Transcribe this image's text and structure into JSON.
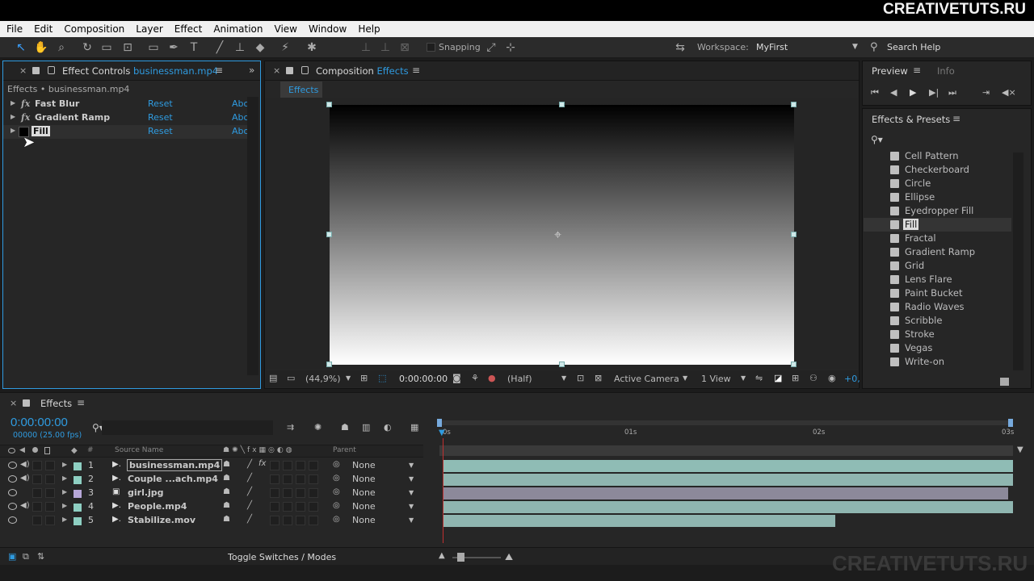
{
  "brand": "CREATIVETUTS.RU",
  "watermark": "CREATIVETUTS.RU",
  "menu": [
    "File",
    "Edit",
    "Composition",
    "Layer",
    "Effect",
    "Animation",
    "View",
    "Window",
    "Help"
  ],
  "toolbar": {
    "snapping_label": "Snapping",
    "workspace_label": "Workspace:",
    "workspace_value": "MyFirst",
    "search_help": "Search Help"
  },
  "effect_controls": {
    "tab_title": "Effect Controls",
    "tab_layer": "businessman.mp4",
    "breadcrumb": "Effects • businessman.mp4",
    "effects": [
      {
        "name": "Fast Blur",
        "reset": "Reset",
        "about": "Abo"
      },
      {
        "name": "Gradient Ramp",
        "reset": "Reset",
        "about": "Abo"
      },
      {
        "name": "Fill",
        "reset": "Reset",
        "about": "Abo"
      }
    ]
  },
  "composition": {
    "tab_title": "Composition",
    "tab_name": "Effects",
    "sub_tab": "Effects",
    "zoom": "(44,9%)",
    "timecode": "0:00:00:00",
    "resolution": "(Half)",
    "camera": "Active Camera",
    "views": "1 View",
    "offset": "+0,"
  },
  "preview": {
    "tab_preview": "Preview",
    "tab_info": "Info"
  },
  "effects_presets": {
    "title": "Effects & Presets",
    "items": [
      "Cell Pattern",
      "Checkerboard",
      "Circle",
      "Ellipse",
      "Eyedropper Fill",
      "Fill",
      "Fractal",
      "Gradient Ramp",
      "Grid",
      "Lens Flare",
      "Paint Bucket",
      "Radio Waves",
      "Scribble",
      "Stroke",
      "Vegas",
      "Write-on"
    ],
    "selected": "Fill"
  },
  "timeline": {
    "tab_name": "Effects",
    "timecode": "0:00:00:00",
    "frames": "00000 (25.00 fps)",
    "col_source": "Source Name",
    "col_parent": "Parent",
    "col_num": "#",
    "ruler": [
      "0s",
      "01s",
      "02s",
      "03s"
    ],
    "layers": [
      {
        "num": "1",
        "name": "businessman.mp4",
        "parent": "None",
        "color": "#8ecfc2",
        "bar": "#8fbcb5"
      },
      {
        "num": "2",
        "name": "Couple ...ach.mp4",
        "parent": "None",
        "color": "#8ecfc2",
        "bar": "#8fb5b0"
      },
      {
        "num": "3",
        "name": "girl.jpg",
        "parent": "None",
        "color": "#b7a7d8",
        "bar": "#8c899a"
      },
      {
        "num": "4",
        "name": "People.mp4",
        "parent": "None",
        "color": "#8ecfc2",
        "bar": "#8fb5b0"
      },
      {
        "num": "5",
        "name": "Stabilize.mov",
        "parent": "None",
        "color": "#8ecfc2",
        "bar": "#8fb5b0"
      }
    ],
    "toggle_label": "Toggle Switches / Modes"
  }
}
